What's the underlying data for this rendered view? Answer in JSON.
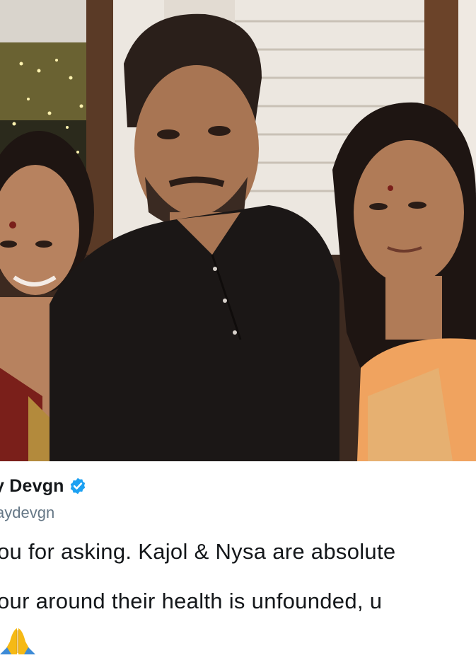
{
  "photo": {
    "alt_subject": "family-photo",
    "colors": {
      "shirt": "#1b1716",
      "skin": "#b7825f",
      "hair": "#1e1512",
      "saree_orange": "#f0a35f",
      "saree_red": "#7a1f1a",
      "wall": "#e8e2db",
      "wood": "#6b4329"
    }
  },
  "tweet": {
    "author_name": "y Devgn",
    "verified_icon": "verified-badge-icon",
    "handle": "aydevgn",
    "text_line1": "ou for asking. Kajol & Nysa are absolute",
    "text_line2": "our around their health is unfounded, u",
    "emoji_icon": "folded-hands-icon",
    "colors": {
      "name": "#14171a",
      "handle": "#657786",
      "verified": "#1da1f2",
      "emoji": "#f5b915"
    }
  }
}
